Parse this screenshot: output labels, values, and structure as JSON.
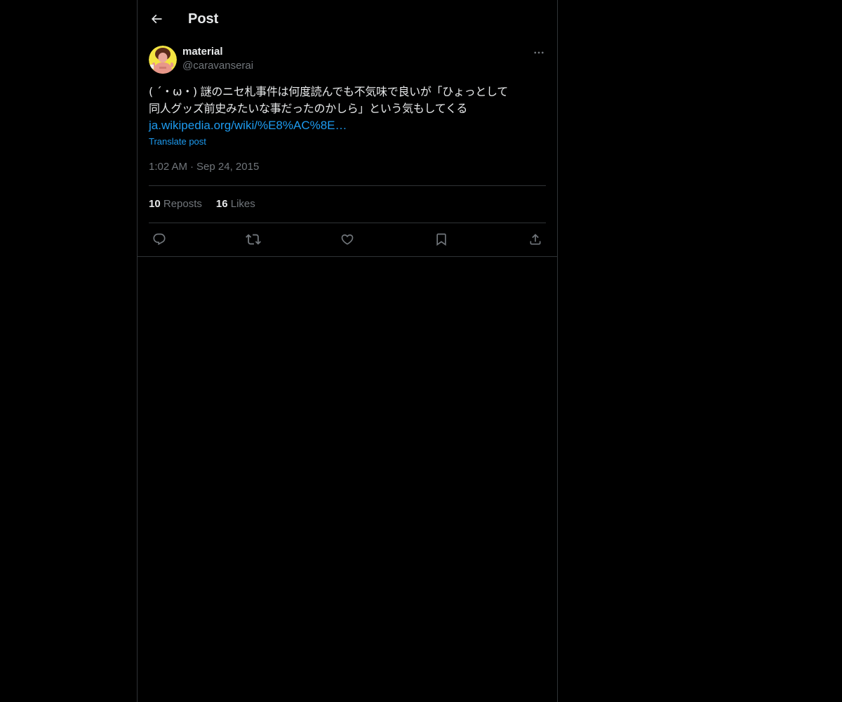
{
  "header": {
    "title": "Post",
    "back_icon": "arrow-left-icon"
  },
  "post": {
    "author": {
      "display_name": "material",
      "handle": "@caravanserai",
      "avatar_icon": "avatar-image"
    },
    "more_icon": "more-horizontal-icon",
    "text": "( ´・ω・) 謎のニセ札事件は何度読んでも不気味で良いが「ひょっとして\n同人グッズ前史みたいな事だったのかしら」という気もしてくる",
    "link": "ja.wikipedia.org/wiki/%E8%AC%8E…",
    "translate_label": "Translate post",
    "time": "1:02 AM",
    "separator": "·",
    "date": "Sep 24, 2015",
    "stats": {
      "reposts_count": "10",
      "reposts_label": "Reposts",
      "likes_count": "16",
      "likes_label": "Likes"
    },
    "actions": [
      {
        "icon": "reply-icon"
      },
      {
        "icon": "repost-icon"
      },
      {
        "icon": "like-icon"
      },
      {
        "icon": "bookmark-icon"
      },
      {
        "icon": "share-icon"
      }
    ]
  },
  "colors": {
    "background": "#000000",
    "text": "#e7e9ea",
    "secondary_text": "#71767b",
    "accent": "#1d9bf0",
    "border": "#2f3336"
  }
}
